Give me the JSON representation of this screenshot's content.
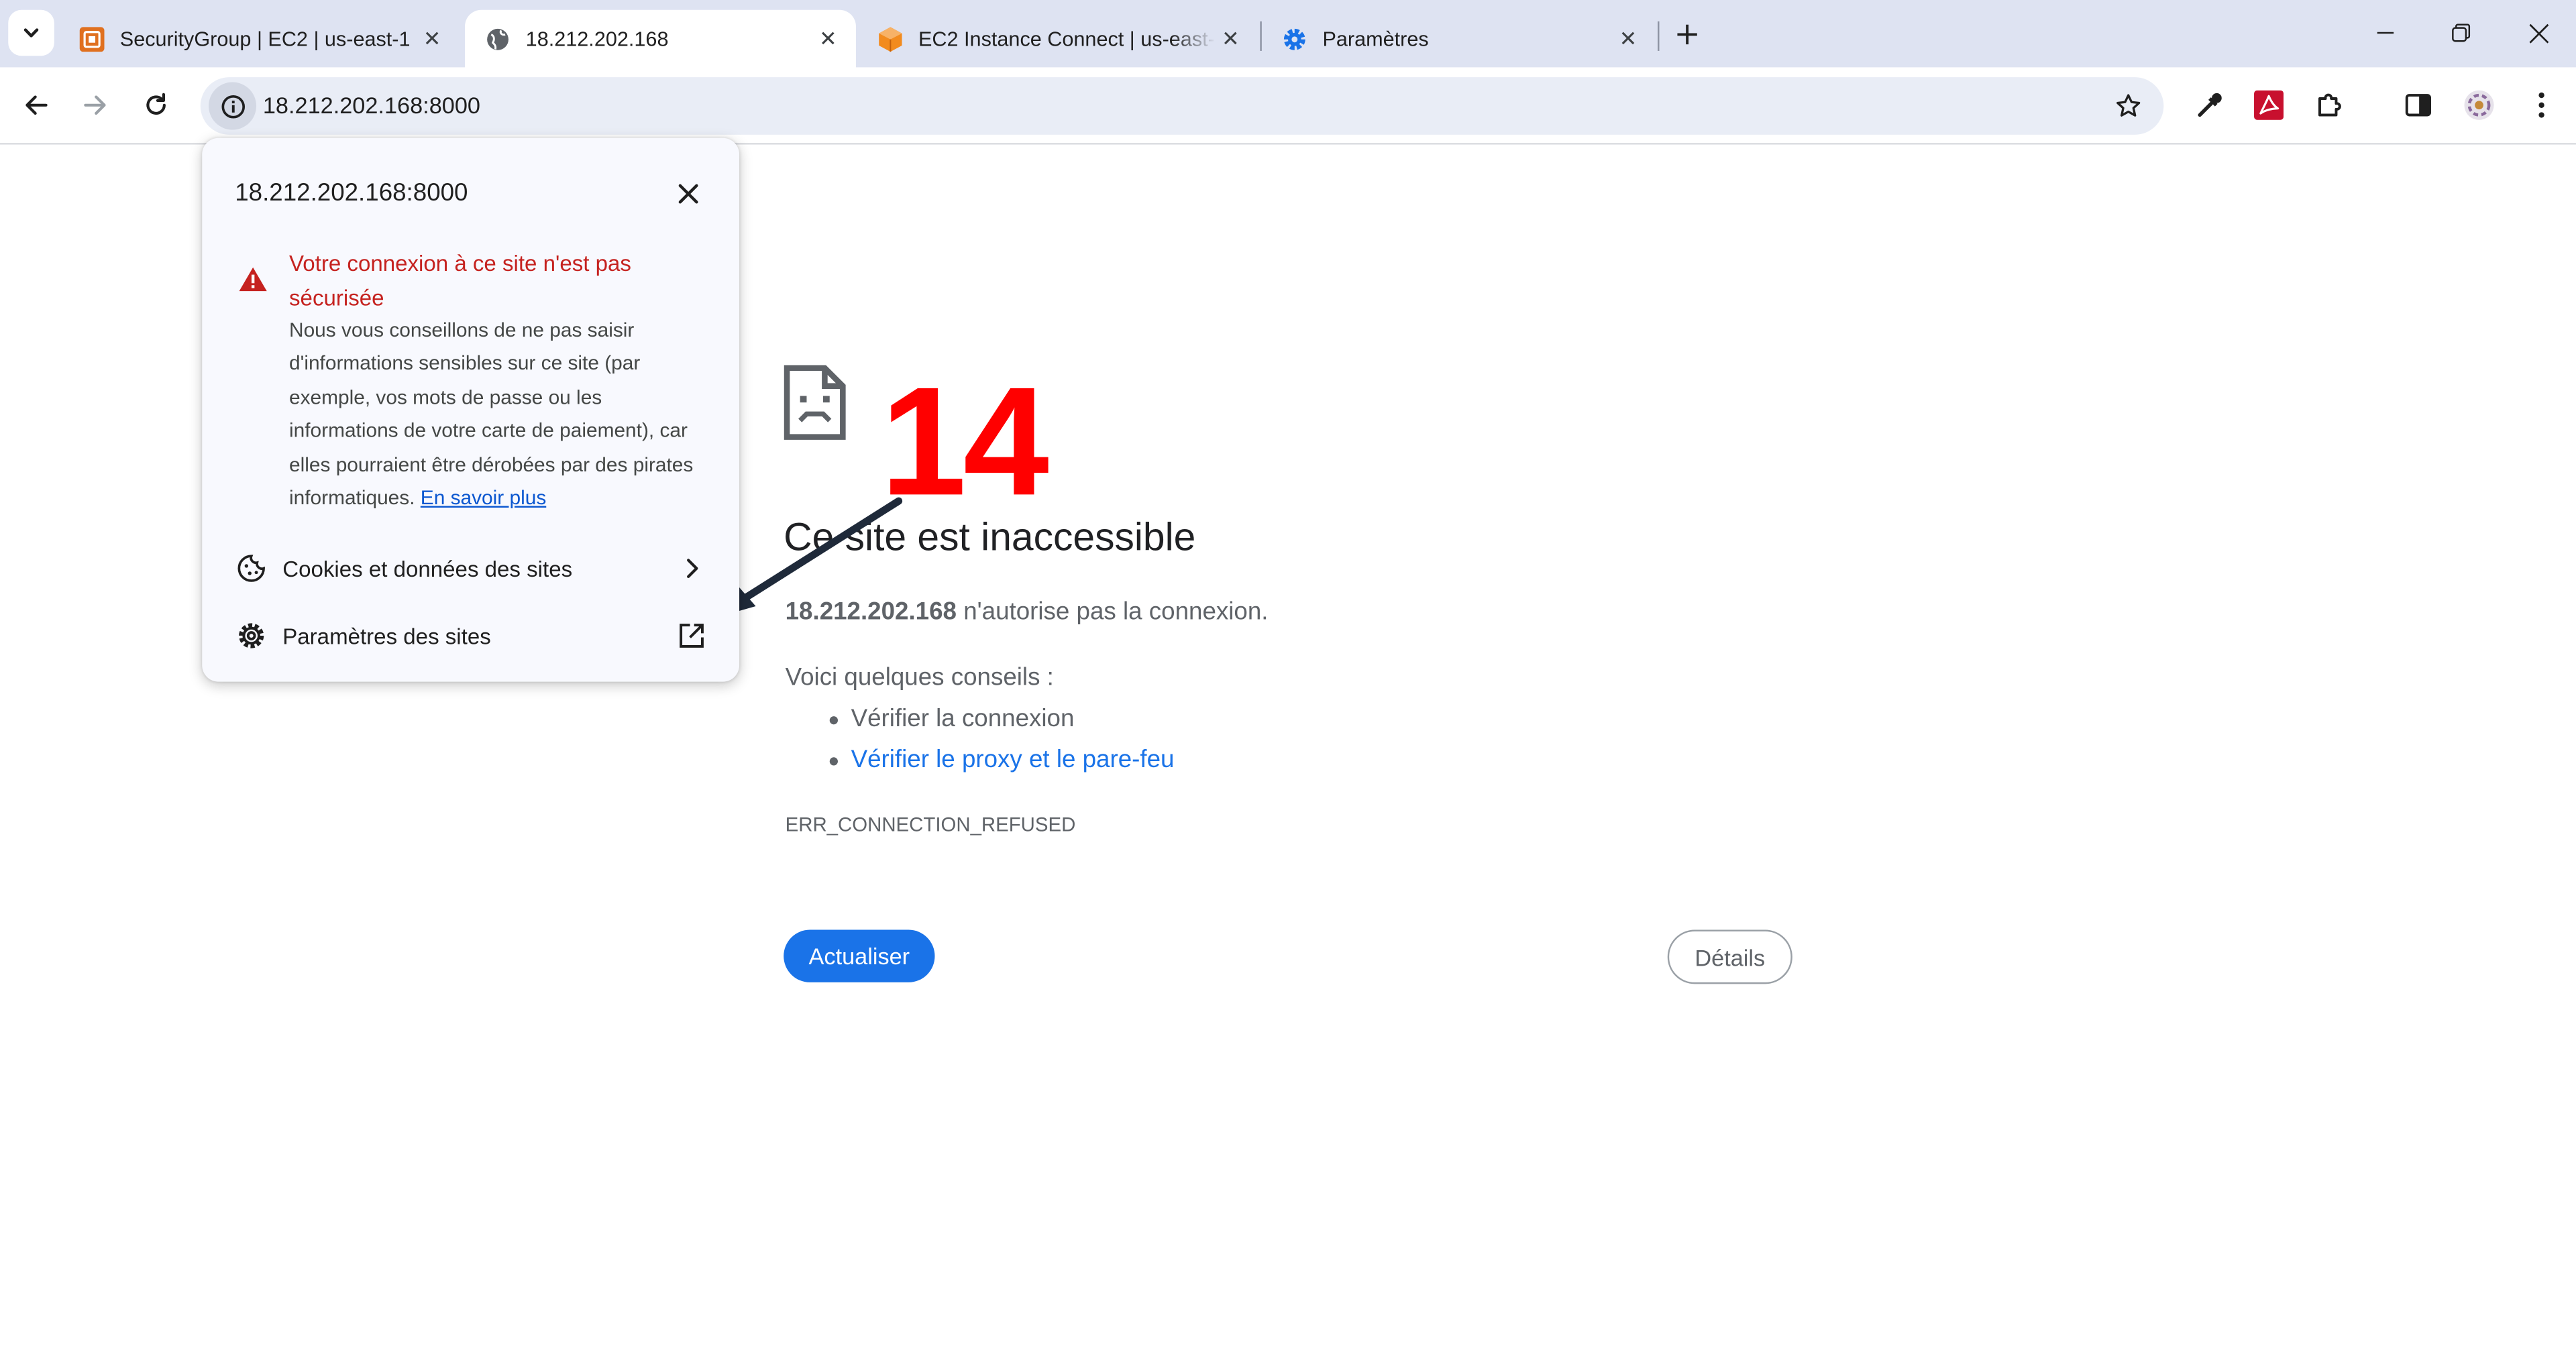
{
  "tabs": [
    {
      "title": "SecurityGroup | EC2 | us-east-1",
      "icon": "aws-securitygroup-icon",
      "active": false
    },
    {
      "title": "18.212.202.168",
      "icon": "globe-icon",
      "active": true
    },
    {
      "title": "EC2 Instance Connect | us-east-",
      "icon": "aws-ec2-icon",
      "active": false
    },
    {
      "title": "Paramètres",
      "icon": "settings-gear-icon",
      "active": false
    }
  ],
  "toolbar": {
    "url": "18.212.202.168:8000"
  },
  "popup": {
    "host": "18.212.202.168:8000",
    "warning_title": "Votre connexion à ce site n'est pas sécurisée",
    "warning_body": "Nous vous conseillons de ne pas saisir d'informations sensibles sur ce site (par exemple, vos mots de passe ou les informations de votre carte de paiement), car elles pourraient être dérobées par des pirates informatiques.",
    "learn_more": "En savoir plus",
    "cookies_label": "Cookies et données des sites",
    "site_settings_label": "Paramètres des sites"
  },
  "error_page": {
    "title": "Ce site est inaccessible",
    "host_bold": "18.212.202.168",
    "host_message": " n'autorise pas la connexion.",
    "tips_heading": "Voici quelques conseils :",
    "tips": [
      "Vérifier la connexion",
      "Vérifier le proxy et le pare-feu"
    ],
    "error_code": "ERR_CONNECTION_REFUSED",
    "reload_label": "Actualiser",
    "details_label": "Détails"
  },
  "annotation": {
    "step_number": "14",
    "color": "#ff0000"
  },
  "colors": {
    "tabstrip_bg": "#dee3f2",
    "omnibox_bg": "#e9edf6",
    "primary_blue": "#1a73e8",
    "warning_red": "#c5221f"
  }
}
